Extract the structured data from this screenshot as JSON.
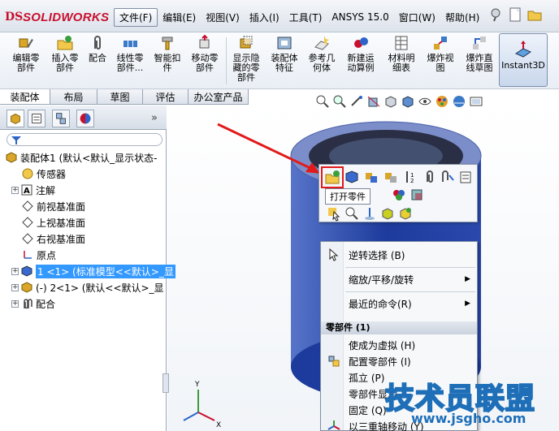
{
  "app": {
    "logo_text": "SOLIDWORKS",
    "logo_mark": "DS"
  },
  "menubar": {
    "items": [
      "文件(F)",
      "编辑(E)",
      "视图(V)",
      "插入(I)",
      "工具(T)",
      "ANSYS 15.0",
      "窗口(W)",
      "帮助(H)"
    ]
  },
  "commands": [
    {
      "label1": "编辑零",
      "label2": "部件"
    },
    {
      "label1": "插入零",
      "label2": "部件"
    },
    {
      "label1": "配合",
      "label2": ""
    },
    {
      "label1": "线性零",
      "label2": "部件..."
    },
    {
      "label1": "智能扣",
      "label2": "件"
    },
    {
      "label1": "移动零",
      "label2": "部件"
    },
    {
      "label1": "显示隐",
      "label2": "藏的零",
      "label3": "部件"
    },
    {
      "label1": "装配体",
      "label2": "特征"
    },
    {
      "label1": "参考几",
      "label2": "何体"
    },
    {
      "label1": "新建运",
      "label2": "动算例"
    },
    {
      "label1": "材料明",
      "label2": "细表"
    },
    {
      "label1": "爆炸视",
      "label2": "图"
    },
    {
      "label1": "爆炸直",
      "label2": "线草图"
    }
  ],
  "instant3d": {
    "label": "Instant3D"
  },
  "tabs": [
    "装配体",
    "布局",
    "草图",
    "评估",
    "办公室产品"
  ],
  "tree": {
    "root": "装配体1 (默认<默认_显示状态-",
    "items": [
      {
        "label": "传感器",
        "expandable": false
      },
      {
        "label": "注解",
        "expandable": true
      },
      {
        "label": "前视基准面",
        "expandable": false
      },
      {
        "label": "上视基准面",
        "expandable": false
      },
      {
        "label": "右视基准面",
        "expandable": false
      },
      {
        "label": "原点",
        "expandable": false
      },
      {
        "label": "1 <1> (标准模型<<默认>_显",
        "expandable": true,
        "selected": true
      },
      {
        "label": "(-) 2<1> (默认<<默认>_显",
        "expandable": true
      },
      {
        "label": "配合",
        "expandable": true
      }
    ],
    "chevron": "»"
  },
  "tooltip": {
    "text": "打开零件"
  },
  "context_menu": {
    "items": [
      {
        "label": "逆转选择 (B)"
      },
      {
        "label": "缩放/平移/旋转",
        "submenu": true
      },
      {
        "label": "最近的命令(R)",
        "submenu": true
      }
    ],
    "section_header": "零部件 (1)",
    "section_items": [
      {
        "label": "使成为虚拟 (H)"
      },
      {
        "label": "配置零部件 (I)"
      },
      {
        "label": "孤立 (P)"
      },
      {
        "label": "零部件显示"
      },
      {
        "label": "固定 (Q)"
      },
      {
        "label": "以三重轴移动 (Y)"
      }
    ]
  },
  "watermark": {
    "main": "技术员联盟",
    "site": "www.jsgho.com"
  },
  "colors": {
    "brand": "#c8102e",
    "selection": "#3399ff",
    "highlight_box": "#e21a1a",
    "arrow": "#e21a1a",
    "cylinder": "#2c4aa8"
  }
}
